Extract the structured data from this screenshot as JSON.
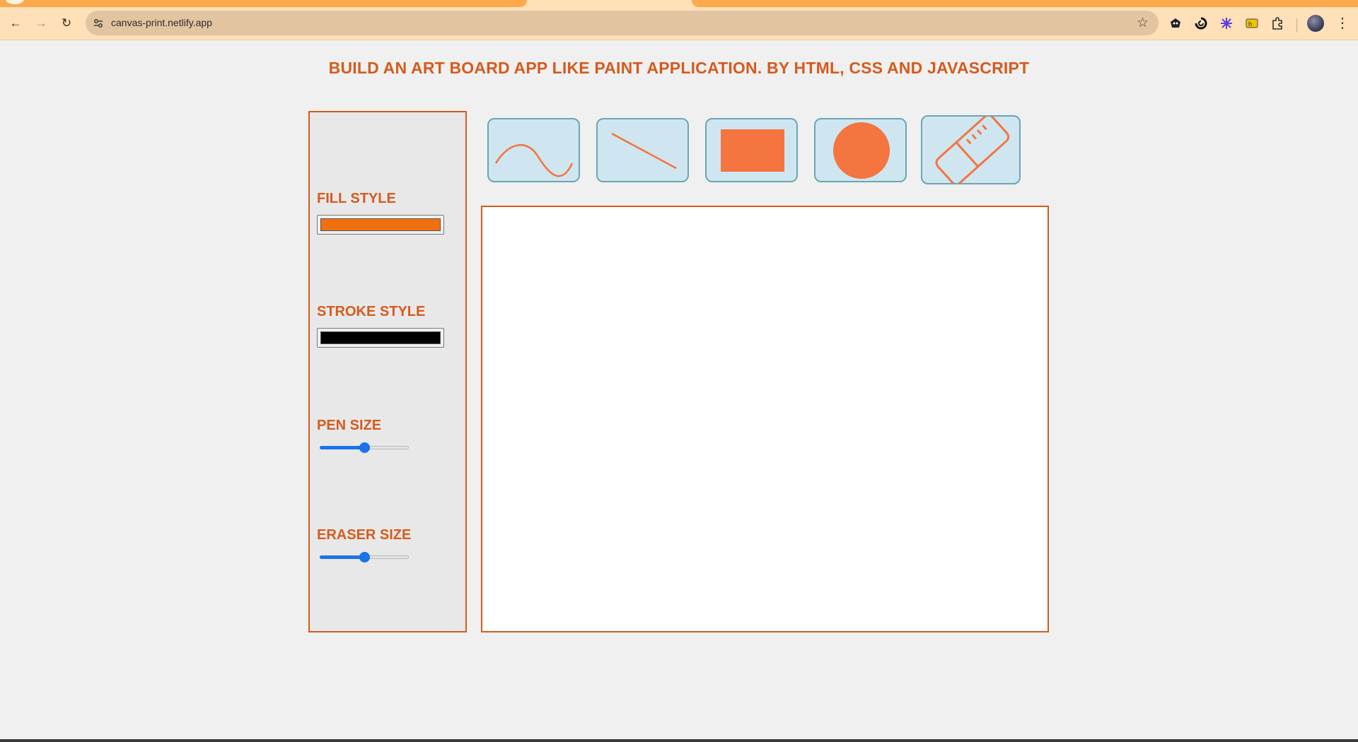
{
  "browser": {
    "url": "canvas-print.netlify.app",
    "back_icon": "←",
    "forward_icon": "→",
    "reload_icon": "↻",
    "bookmark_icon": "☆",
    "menu_icon": "⋮"
  },
  "page": {
    "title": "BUILD AN ART BOARD APP LIKE PAINT APPLICATION. BY HTML, CSS AND JAVASCRIPT"
  },
  "sidebar": {
    "fill_style_label": "FILL STYLE",
    "fill_color": "#f07010",
    "stroke_style_label": "STROKE STYLE",
    "stroke_color": "#000000",
    "pen_size_label": "PEN SIZE",
    "pen_size_percent": 50,
    "eraser_size_label": "ERASER SIZE",
    "eraser_size_percent": 50
  },
  "tools": [
    {
      "name": "pencil",
      "icon": "wave-icon"
    },
    {
      "name": "line",
      "icon": "line-icon"
    },
    {
      "name": "rectangle",
      "icon": "rectangle-icon"
    },
    {
      "name": "circle",
      "icon": "circle-icon"
    },
    {
      "name": "eraser",
      "icon": "eraser-icon"
    }
  ],
  "colors": {
    "accent": "#d55b1d",
    "tool_icon": "#f47540",
    "tool_bg": "#cfe6f0",
    "slider": "#1a73e8"
  }
}
